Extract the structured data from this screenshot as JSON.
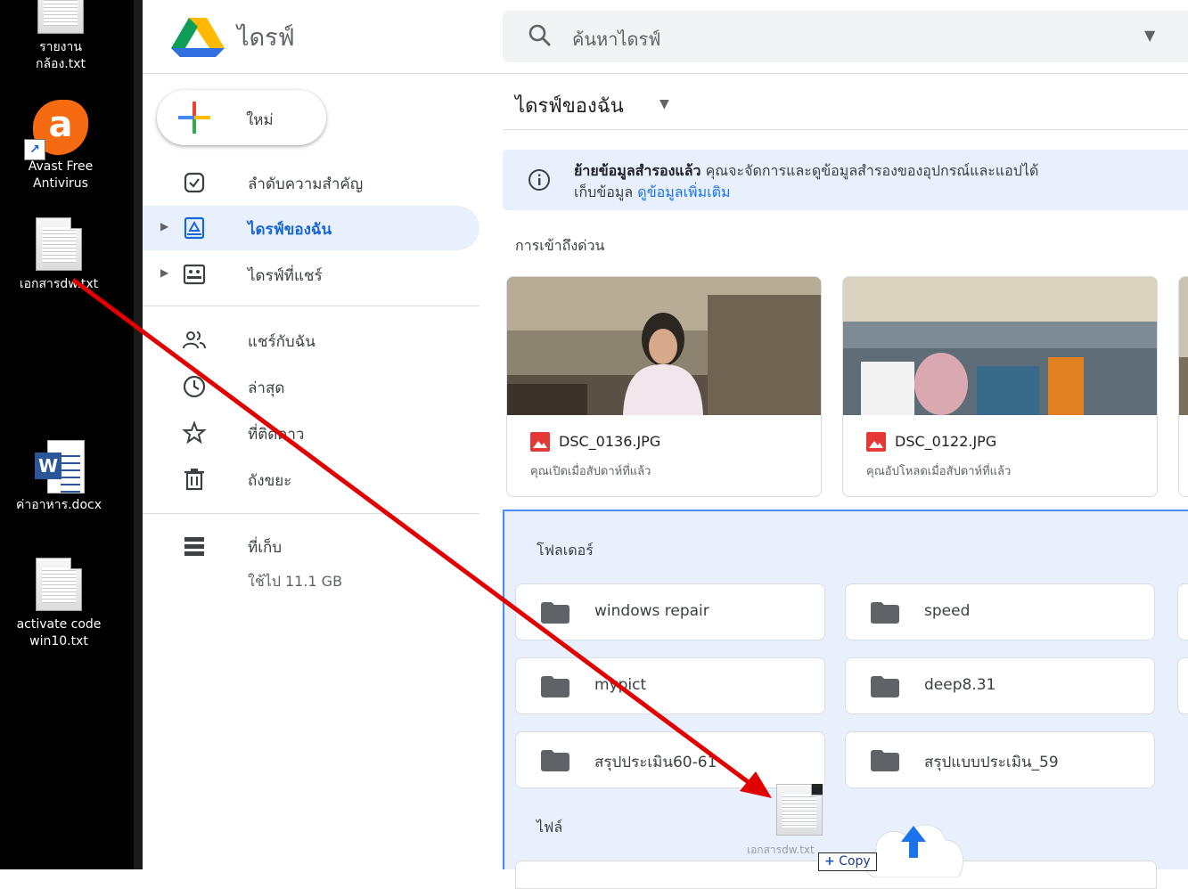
{
  "desktop": {
    "icons": [
      {
        "label_line1": "รายงาน",
        "label_line2": "กล้อง.txt"
      },
      {
        "label_line1": "Avast Free",
        "label_line2": "Antivirus"
      },
      {
        "label_line1": "เอกสารdw.txt",
        "label_line2": ""
      },
      {
        "label_line1": "ค่าอาหาร.docx",
        "label_line2": ""
      },
      {
        "label_line1": "activate code",
        "label_line2": "win10.txt"
      }
    ]
  },
  "header": {
    "app_title": "ไดรฟ์",
    "search_placeholder": "ค้นหาไดรฟ์"
  },
  "sidebar": {
    "new_label": "ใหม่",
    "items": [
      {
        "label": "ลำดับความสำคัญ",
        "icon": "priority-icon"
      },
      {
        "label": "ไดรฟ์ของฉัน",
        "icon": "my-drive-icon"
      },
      {
        "label": "ไดรฟ์ที่แชร์",
        "icon": "shared-drives-icon"
      },
      {
        "label": "แชร์กับฉัน",
        "icon": "shared-with-me-icon"
      },
      {
        "label": "ล่าสุด",
        "icon": "clock-icon"
      },
      {
        "label": "ที่ติดดาว",
        "icon": "star-icon"
      },
      {
        "label": "ถังขยะ",
        "icon": "trash-icon"
      }
    ],
    "storage_label": "ที่เก็บ",
    "storage_used": "ใช้ไป 11.1 GB"
  },
  "main": {
    "breadcrumb": "ไดรฟ์ของฉัน",
    "banner": {
      "bold": "ย้ายข้อมูลสำรองแล้ว",
      "text": " คุณจะจัดการและดูข้อมูลสำรองของอุปกรณ์และแอปได้",
      "line2": "เก็บข้อมูล ",
      "link": "ดูข้อมูลเพิ่มเติม"
    },
    "quick_access_heading": "การเข้าถึงด่วน",
    "quick_access": [
      {
        "name": "DSC_0136.JPG",
        "subtitle": "คุณเปิดเมื่อสัปดาห์ที่แล้ว"
      },
      {
        "name": "DSC_0122.JPG",
        "subtitle": "คุณอัปโหลดเมื่อสัปดาห์ที่แล้ว"
      }
    ],
    "folders_heading": "โฟลเดอร์",
    "folders": [
      "windows repair",
      "speed",
      "mypict",
      "deep8.31",
      "สรุปประเมิน60-61",
      "สรุปแบบประเมิน_59"
    ],
    "files_heading": "ไฟล์"
  },
  "drag": {
    "file_name": "เอกสารdw.txt",
    "copy_label": "Copy",
    "copy_plus": "+"
  },
  "colors": {
    "accent": "#1967d2",
    "active_bg": "#e8f0fe",
    "drop_border": "#4a8af4",
    "arrow": "#e00000"
  }
}
